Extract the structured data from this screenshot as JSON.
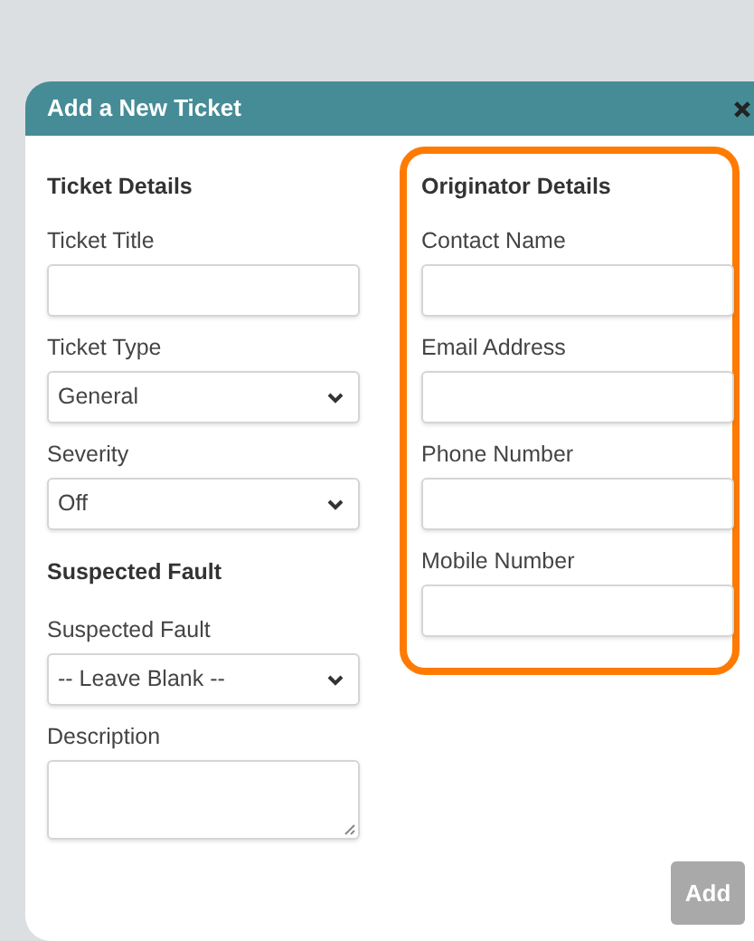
{
  "dialog": {
    "title": "Add a New Ticket",
    "columns": [
      {
        "highlighted": false,
        "items": [
          {
            "kind": "heading",
            "text": "Ticket Details"
          },
          {
            "kind": "text",
            "label": "Ticket Title"
          },
          {
            "kind": "select",
            "label": "Ticket Type",
            "value": "General"
          },
          {
            "kind": "select",
            "label": "Severity",
            "value": "Off"
          },
          {
            "kind": "heading",
            "text": "Suspected Fault"
          },
          {
            "kind": "select",
            "label": "Suspected Fault",
            "value": "-- Leave Blank --"
          },
          {
            "kind": "textarea",
            "label": "Description"
          }
        ]
      },
      {
        "highlighted": true,
        "items": [
          {
            "kind": "heading",
            "text": "Originator Details"
          },
          {
            "kind": "text",
            "label": "Contact Name"
          },
          {
            "kind": "text",
            "label": "Email Address"
          },
          {
            "kind": "text",
            "label": "Phone Number"
          },
          {
            "kind": "text",
            "label": "Mobile Number"
          }
        ]
      }
    ],
    "add_button": {
      "label": "Add",
      "disabled": true
    }
  }
}
